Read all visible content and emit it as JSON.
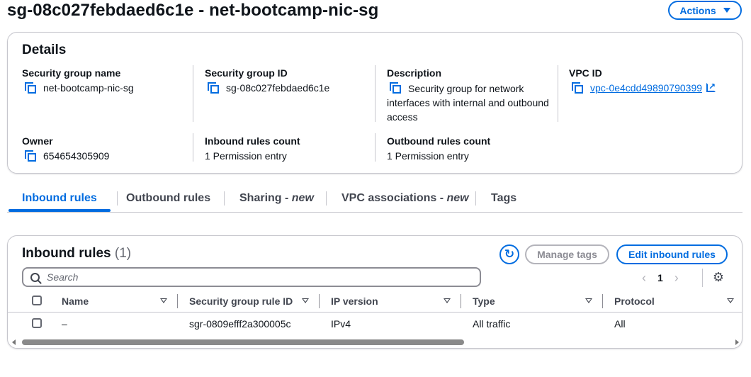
{
  "header": {
    "title": "sg-08c027febdaed6c1e - net-bootcamp-nic-sg",
    "actions_label": "Actions"
  },
  "details": {
    "title": "Details",
    "security_group_name": {
      "label": "Security group name",
      "value": "net-bootcamp-nic-sg"
    },
    "security_group_id": {
      "label": "Security group ID",
      "value": "sg-08c027febdaed6c1e"
    },
    "description": {
      "label": "Description",
      "value": "Security group for network interfaces with internal and outbound access"
    },
    "vpc_id": {
      "label": "VPC ID",
      "value": "vpc-0e4cdd49890790399"
    },
    "owner": {
      "label": "Owner",
      "value": "654654305909"
    },
    "inbound_rules_count": {
      "label": "Inbound rules count",
      "value": "1 Permission entry"
    },
    "outbound_rules_count": {
      "label": "Outbound rules count",
      "value": "1 Permission entry"
    }
  },
  "tabs": {
    "inbound": "Inbound rules",
    "outbound": "Outbound rules",
    "sharing": "Sharing - ",
    "sharing_new": "new",
    "vpc_assoc": "VPC associations - ",
    "vpc_assoc_new": "new",
    "tags": "Tags",
    "active": "Inbound rules"
  },
  "rules": {
    "title": "Inbound rules",
    "count": "(1)",
    "manage_tags_label": "Manage tags",
    "edit_label": "Edit inbound rules",
    "search_placeholder": "Search",
    "page": "1",
    "columns": {
      "name": "Name",
      "rule_id": "Security group rule ID",
      "ip_version": "IP version",
      "type": "Type",
      "protocol": "Protocol"
    },
    "rows": [
      {
        "name": "–",
        "rule_id": "sgr-0809efff2a300005c",
        "ip_version": "IPv4",
        "type": "All traffic",
        "protocol": "All"
      }
    ]
  },
  "icons": {
    "copy": "copy-icon",
    "external_link": "external-link-icon",
    "refresh": "refresh-icon",
    "search": "search-icon",
    "settings": "gear-icon"
  },
  "colors": {
    "accent": "#006ce0",
    "text": "#0f141a",
    "border": "#c6c6cd",
    "disabled": "#8c8c94"
  }
}
